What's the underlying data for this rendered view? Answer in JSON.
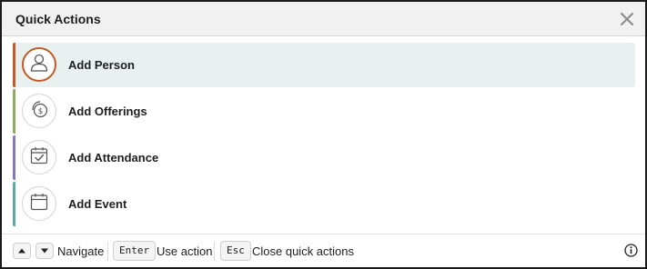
{
  "dialog": {
    "title": "Quick Actions",
    "close_icon": "close-icon"
  },
  "actions": [
    {
      "label": "Add Person",
      "icon": "person-icon",
      "accent": "#c05a26",
      "selected": true
    },
    {
      "label": "Add Offerings",
      "icon": "offering-icon",
      "accent": "#8cab5f",
      "selected": false
    },
    {
      "label": "Add Attendance",
      "icon": "calendar-check-icon",
      "accent": "#8a79b8",
      "selected": false
    },
    {
      "label": "Add Event",
      "icon": "calendar-icon",
      "accent": "#5fa7a5",
      "selected": false
    }
  ],
  "footer": {
    "navigate_label": "Navigate",
    "enter_key": "Enter",
    "use_action_label": "Use action",
    "esc_key": "Esc",
    "close_label": "Close quick actions",
    "info_icon": "info-icon"
  },
  "colors": {
    "selected_bg": "#e8f1ef",
    "header_bg": "#f1f1f1"
  }
}
